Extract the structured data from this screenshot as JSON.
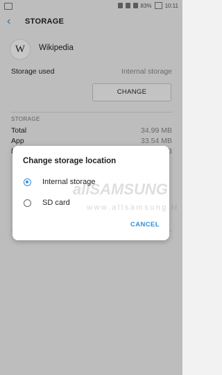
{
  "status_bar": {
    "battery": "83%",
    "time": "10:11"
  },
  "header": {
    "title": "STORAGE"
  },
  "app": {
    "logo_letter": "W",
    "name": "Wikipedia"
  },
  "storage_used": {
    "label": "Storage used",
    "value": "Internal storage",
    "change_button": "CHANGE"
  },
  "storage_section": {
    "heading": "STORAGE",
    "rows": [
      {
        "label": "Total",
        "value": "34.99 MB"
      },
      {
        "label": "App",
        "value": "33.54 MB"
      },
      {
        "label": "D",
        "value": "3"
      }
    ]
  },
  "dialog": {
    "title": "Change storage location",
    "options": [
      {
        "label": "Internal storage",
        "selected": true
      },
      {
        "label": "SD card",
        "selected": false
      }
    ],
    "cancel": "CANCEL"
  },
  "watermark": {
    "brand": "allSAMSUNG",
    "url": "www.allsamsung.ir"
  },
  "colors": {
    "accent": "#2f8fdc"
  }
}
